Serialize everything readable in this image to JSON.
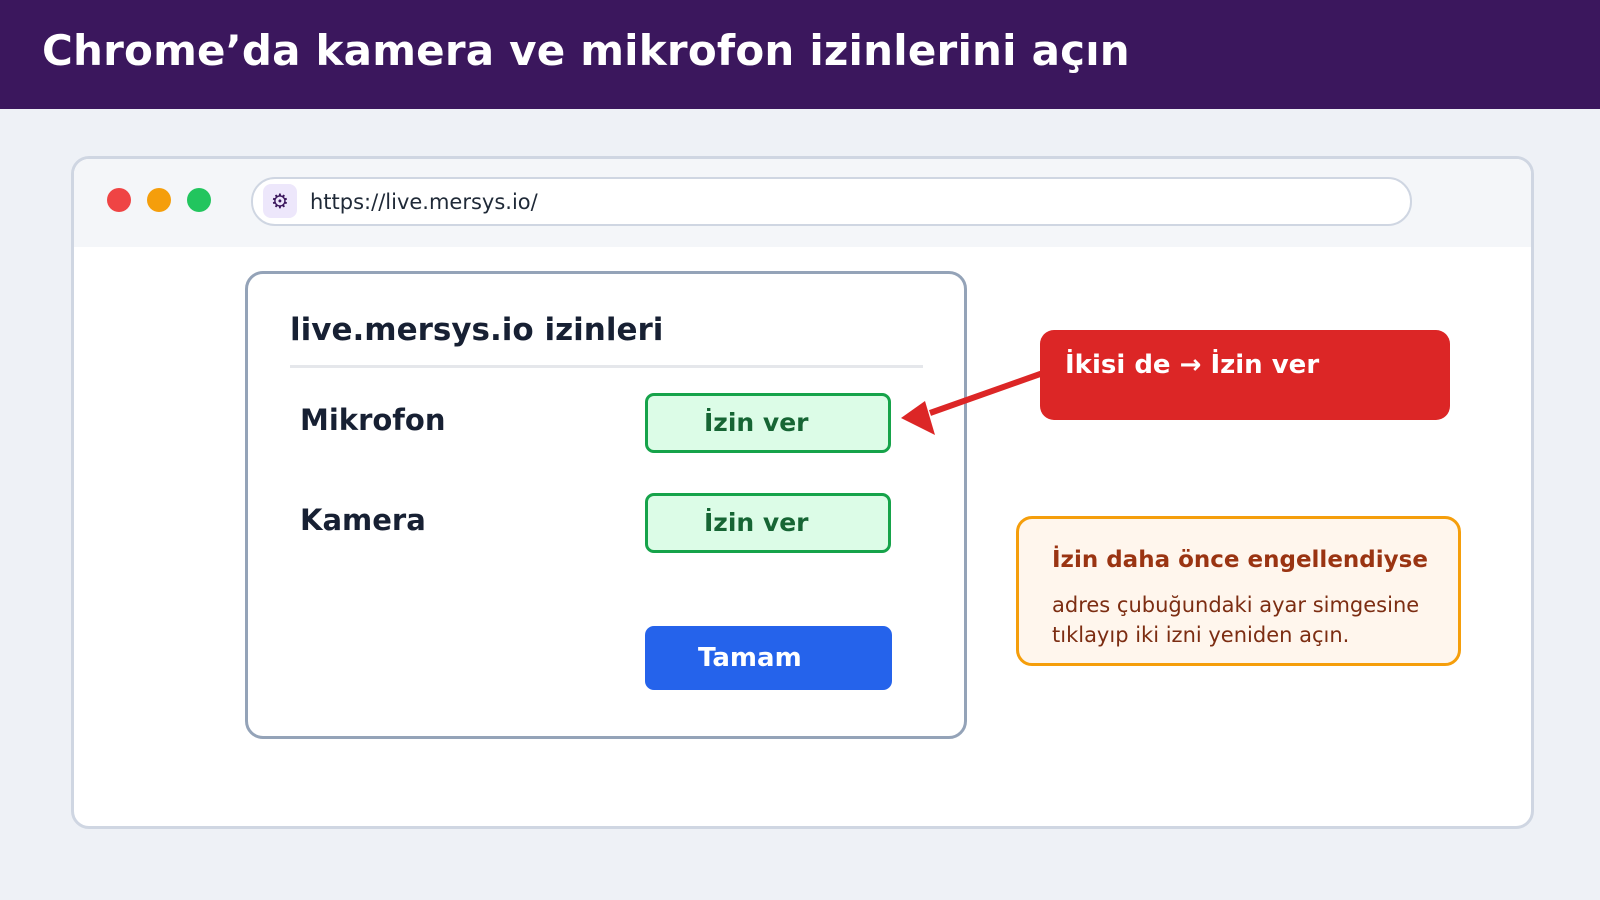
{
  "header": {
    "title": "Chrome’da kamera ve mikrofon izinlerini açın"
  },
  "browser": {
    "url": "https://live.mersys.io/",
    "site_settings_icon": "gear-icon"
  },
  "dialog": {
    "title": "live.mersys.io izinleri",
    "permissions": [
      {
        "label": "Mikrofon",
        "action": "İzin ver"
      },
      {
        "label": "Kamera",
        "action": "İzin ver"
      }
    ],
    "ok_label": "Tamam"
  },
  "callout": {
    "text": "İkisi de → İzin ver"
  },
  "note": {
    "title": "İzin daha önce engellendiyse",
    "line1": "adres çubuğundaki ayar simgesine",
    "line2": "tıklayıp iki izni yeniden açın."
  },
  "colors": {
    "header_bg": "#3b175d",
    "allow_bg": "#dcfce7",
    "allow_border": "#16a34a",
    "ok_bg": "#2563eb",
    "callout_bg": "#dc2626",
    "note_border": "#f59e0b"
  }
}
